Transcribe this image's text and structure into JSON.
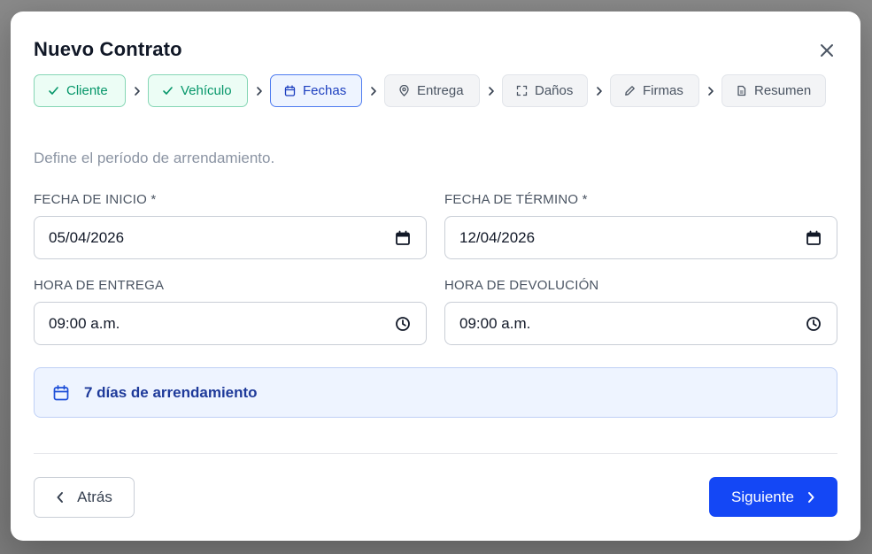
{
  "modal": {
    "title": "Nuevo Contrato",
    "close_icon": "close-icon"
  },
  "steps": [
    {
      "label": "Cliente",
      "status": "done",
      "icon": "check-icon"
    },
    {
      "label": "Vehículo",
      "status": "done",
      "icon": "check-icon"
    },
    {
      "label": "Fechas",
      "status": "active",
      "icon": "calendar-icon"
    },
    {
      "label": "Entrega",
      "status": "pending",
      "icon": "map-pin-icon"
    },
    {
      "label": "Daños",
      "status": "pending",
      "icon": "scan-icon"
    },
    {
      "label": "Firmas",
      "status": "pending",
      "icon": "pen-icon"
    },
    {
      "label": "Resumen",
      "status": "pending",
      "icon": "file-text-icon"
    }
  ],
  "intro": "Define el período de arrendamiento.",
  "fields": {
    "start_date": {
      "label": "FECHA DE INICIO *",
      "value": "05/04/2026",
      "icon": "calendar-icon"
    },
    "end_date": {
      "label": "FECHA DE TÉRMINO *",
      "value": "12/04/2026",
      "icon": "calendar-icon"
    },
    "delivery_time": {
      "label": "HORA DE ENTREGA",
      "value": "09:00 a.m.",
      "icon": "clock-icon"
    },
    "return_time": {
      "label": "HORA DE DEVOLUCIÓN",
      "value": "09:00 a.m.",
      "icon": "clock-icon"
    }
  },
  "duration": {
    "text": "7 días de arrendamiento",
    "icon": "calendar-icon"
  },
  "footer": {
    "back_label": "Atrás",
    "next_label": "Siguiente"
  },
  "colors": {
    "primary": "#1447f5",
    "done_text": "#059669",
    "done_bg": "#ecfdf5",
    "active_bg": "#eef4ff",
    "pending_bg": "#f3f4f6"
  }
}
